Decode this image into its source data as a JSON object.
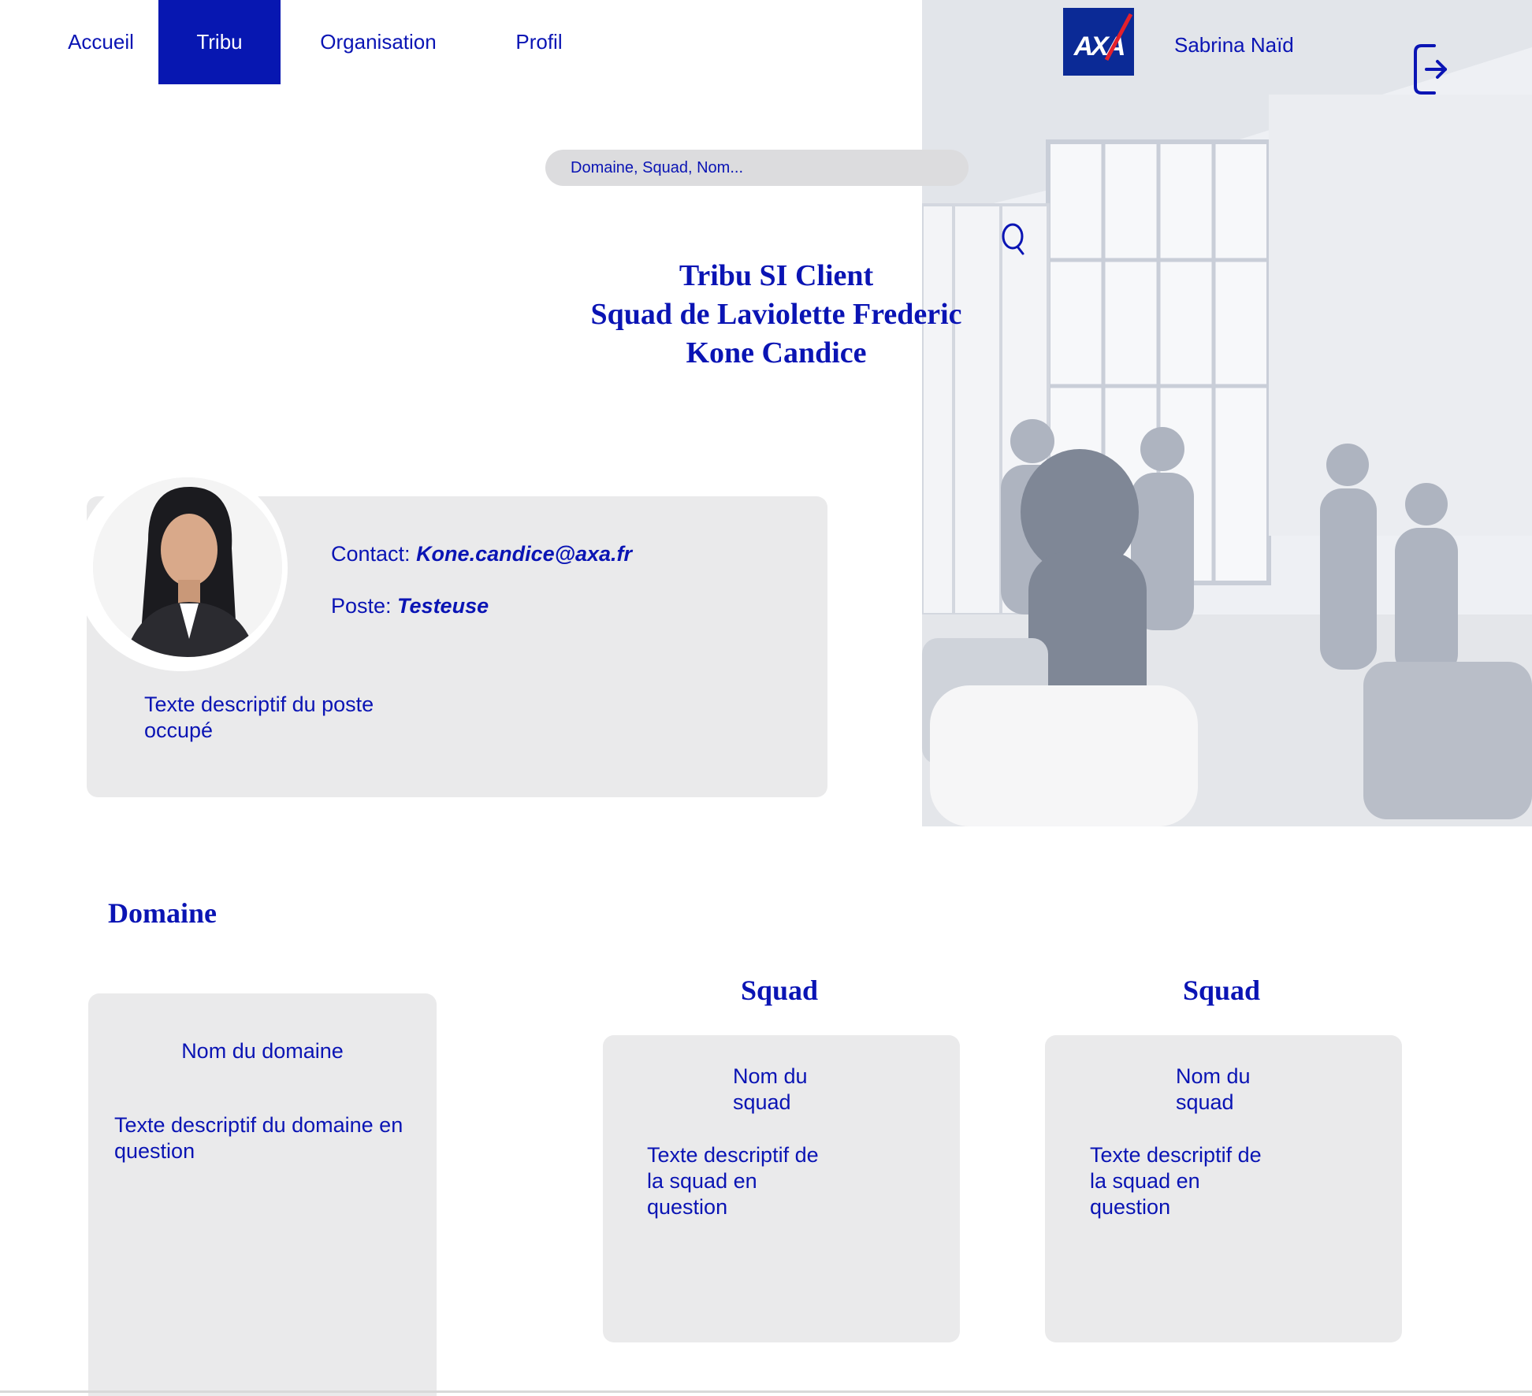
{
  "nav": {
    "items": [
      {
        "label": "Accueil",
        "active": false
      },
      {
        "label": "Tribu",
        "active": true
      },
      {
        "label": "Organisation",
        "active": false
      },
      {
        "label": "Profil",
        "active": false
      }
    ]
  },
  "brand": {
    "logo_text": "AXA"
  },
  "user": {
    "name": "Sabrina Naïd"
  },
  "icons": {
    "logout": "logout-icon",
    "search": "search-icon"
  },
  "search": {
    "placeholder": "Domaine, Squad, Nom..."
  },
  "header": {
    "line1": "Tribu SI Client",
    "line2": "Squad de Laviolette Frederic",
    "line3": "Kone Candice"
  },
  "profile": {
    "contact_label": "Contact: ",
    "contact_value": "Kone.candice@axa.fr",
    "poste_label": "Poste: ",
    "poste_value": "Testeuse",
    "description": "Texte descriptif du poste occupé"
  },
  "domaine": {
    "heading": "Domaine",
    "name": "Nom du domaine",
    "description": "Texte descriptif du domaine en question"
  },
  "squads": [
    {
      "heading": "Squad",
      "name": "Nom du squad",
      "description": "Texte descriptif de la squad en question"
    },
    {
      "heading": "Squad",
      "name": "Nom du squad",
      "description": "Texte descriptif de la squad en question"
    }
  ],
  "colors": {
    "primary": "#0717b1",
    "card": "#eaeaeb",
    "search": "#dcdcde"
  }
}
